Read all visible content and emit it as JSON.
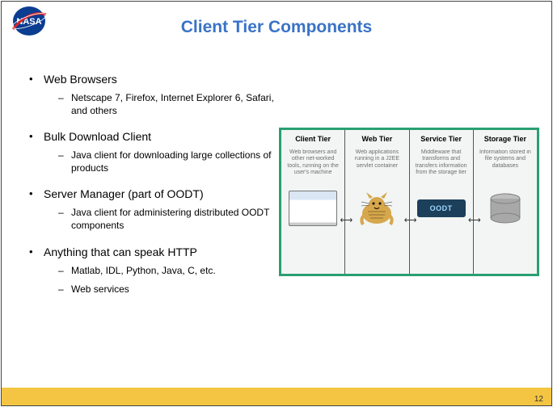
{
  "title": "Client Tier Components",
  "bullets": [
    {
      "label": "Web Browsers",
      "subs": [
        "Netscape 7, Firefox, Internet Explorer 6, Safari, and others"
      ]
    },
    {
      "label": "Bulk Download Client",
      "subs": [
        "Java client for downloading large collections of products"
      ]
    },
    {
      "label": "Server Manager (part of OODT)",
      "subs": [
        "Java client for administering distributed OODT components"
      ]
    },
    {
      "label": "Anything that can speak HTTP",
      "subs": [
        "Matlab, IDL, Python, Java, C, etc.",
        "Web services"
      ]
    }
  ],
  "diagram": {
    "tiers": [
      {
        "title": "Client Tier",
        "text": "Web browsers and other net-worked tools, running on the user's machine"
      },
      {
        "title": "Web Tier",
        "text": "Web applications running in a J2EE servlet container"
      },
      {
        "title": "Service Tier",
        "text": "Middleware that transforms and transfers information from the storage tier"
      },
      {
        "title": "Storage Tier",
        "text": "Information stored in file systems and databases"
      }
    ],
    "oodt_label": "OODT"
  },
  "page_number": "12"
}
